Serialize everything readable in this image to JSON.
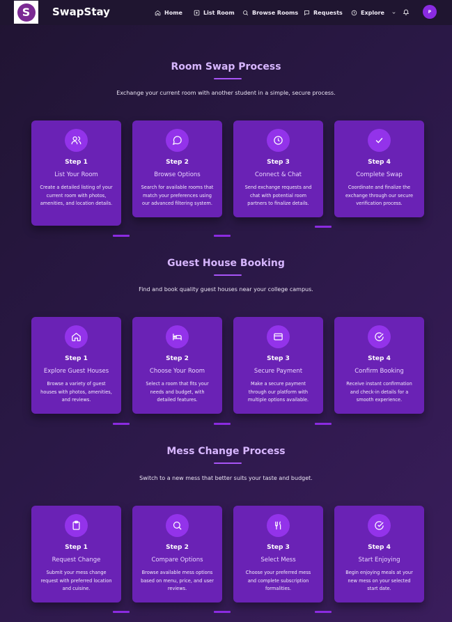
{
  "app": {
    "logo_letter": "S",
    "brand": "SwapStay"
  },
  "nav": {
    "items": [
      {
        "label": "Home",
        "icon": "home-icon"
      },
      {
        "label": "List Room",
        "icon": "plus-square-icon"
      },
      {
        "label": "Browse Rooms",
        "icon": "search-icon"
      },
      {
        "label": "Requests",
        "icon": "message-icon"
      },
      {
        "label": "Explore",
        "icon": "compass-icon"
      }
    ],
    "explore_dropdown_icon": "chevron-down-icon",
    "bell_icon": "bell-icon",
    "avatar_initial": "P"
  },
  "colors": {
    "accent": "#a855f7",
    "card": "#6a22b5",
    "icon_circle": "#9333ea",
    "title": "#d7b6ff"
  },
  "sections": [
    {
      "title": "Room Swap Process",
      "subtitle": "Exchange your current room with another student in a simple, secure process.",
      "cards": [
        {
          "step": "Step 1",
          "title": "List Your Room",
          "icon": "users-icon",
          "desc": "Create a detailed listing of your current room with photos, amenities, and location details."
        },
        {
          "step": "Step 2",
          "title": "Browse Options",
          "icon": "chat-bubble-icon",
          "desc": "Search for available rooms that match your preferences using our advanced filtering system."
        },
        {
          "step": "Step 3",
          "title": "Connect & Chat",
          "icon": "clock-icon",
          "desc": "Send exchange requests and chat with potential room partners to finalize details."
        },
        {
          "step": "Step 4",
          "title": "Complete Swap",
          "icon": "check-icon",
          "desc": "Coordinate and finalize the exchange through our secure verification process."
        }
      ]
    },
    {
      "title": "Guest House Booking",
      "subtitle": "Find and book quality guest houses near your college campus.",
      "cards": [
        {
          "step": "Step 1",
          "title": "Explore Guest Houses",
          "icon": "house-icon",
          "desc": "Browse a variety of guest houses with photos, amenities, and reviews."
        },
        {
          "step": "Step 2",
          "title": "Choose Your Room",
          "icon": "bed-icon",
          "desc": "Select a room that fits your needs and budget, with detailed features."
        },
        {
          "step": "Step 3",
          "title": "Secure Payment",
          "icon": "credit-card-icon",
          "desc": "Make a secure payment through our platform with multiple options available."
        },
        {
          "step": "Step 4",
          "title": "Confirm Booking",
          "icon": "check-circle-icon",
          "desc": "Receive instant confirmation and check-in details for a smooth experience."
        }
      ]
    },
    {
      "title": "Mess Change Process",
      "subtitle": "Switch to a new mess that better suits your taste and budget.",
      "cards": [
        {
          "step": "Step 1",
          "title": "Request Change",
          "icon": "clipboard-icon",
          "desc": "Submit your mess change request with preferred location and cuisine."
        },
        {
          "step": "Step 2",
          "title": "Compare Options",
          "icon": "search-icon",
          "desc": "Browse available mess options based on menu, price, and user reviews."
        },
        {
          "step": "Step 3",
          "title": "Select Mess",
          "icon": "utensils-icon",
          "desc": "Choose your preferred mess and complete subscription formalities."
        },
        {
          "step": "Step 4",
          "title": "Start Enjoying",
          "icon": "check-circle-icon",
          "desc": "Begin enjoying meals at your new mess on your selected start date."
        }
      ]
    }
  ]
}
